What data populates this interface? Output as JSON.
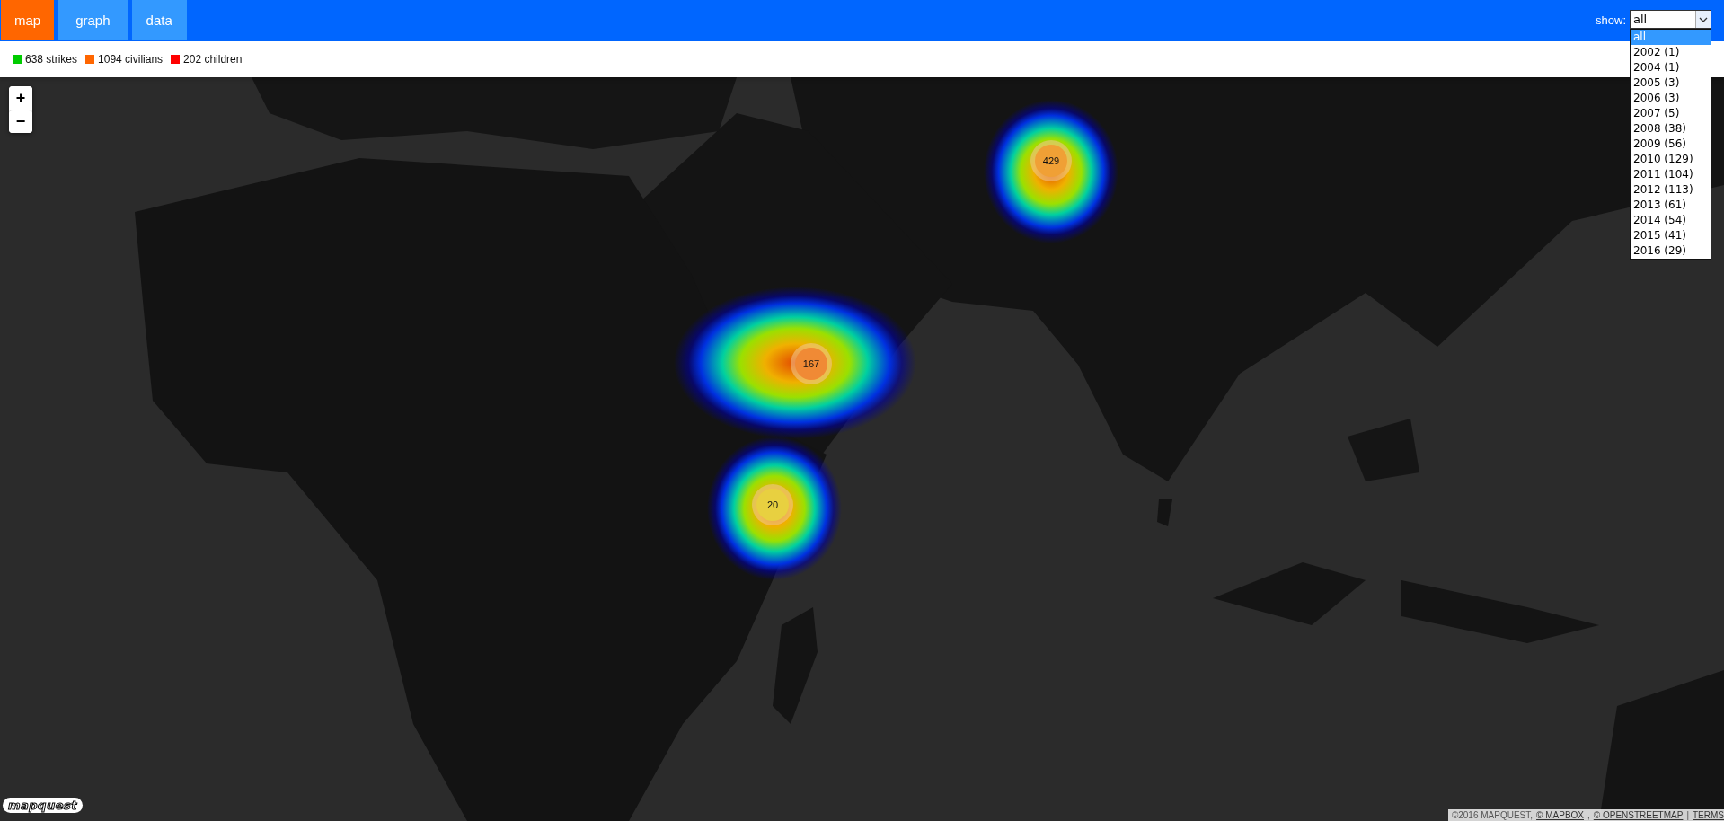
{
  "tabs": [
    {
      "label": "map",
      "selected": true
    },
    {
      "label": "graph",
      "selected": false
    },
    {
      "label": "data",
      "selected": false
    }
  ],
  "filter": {
    "label": "show:",
    "value": "all",
    "expanded": true,
    "options": [
      {
        "label": "all",
        "selected": true
      },
      {
        "label": "2002 (1)",
        "selected": false
      },
      {
        "label": "2004 (1)",
        "selected": false
      },
      {
        "label": "2005 (3)",
        "selected": false
      },
      {
        "label": "2006 (3)",
        "selected": false
      },
      {
        "label": "2007 (5)",
        "selected": false
      },
      {
        "label": "2008 (38)",
        "selected": false
      },
      {
        "label": "2009 (56)",
        "selected": false
      },
      {
        "label": "2010 (129)",
        "selected": false
      },
      {
        "label": "2011 (104)",
        "selected": false
      },
      {
        "label": "2012 (113)",
        "selected": false
      },
      {
        "label": "2013 (61)",
        "selected": false
      },
      {
        "label": "2014 (54)",
        "selected": false
      },
      {
        "label": "2015 (41)",
        "selected": false
      },
      {
        "label": "2016 (29)",
        "selected": false
      }
    ]
  },
  "legend": [
    {
      "label": "638 strikes",
      "color": "#00cc00"
    },
    {
      "label": "1094 civilians",
      "color": "#ff6600"
    },
    {
      "label": "202 children",
      "color": "#ff0000"
    }
  ],
  "map": {
    "kind": "picture",
    "zoom_in": "+",
    "zoom_out": "−",
    "clusters": [
      {
        "count": "429",
        "color": "#f0a035"
      },
      {
        "count": "167",
        "color": "#f08a35"
      },
      {
        "count": "20",
        "color": "#e8d040"
      }
    ],
    "logo": "mapquest",
    "attribution": [
      {
        "text": "©2016 MAPQUEST,",
        "link": false
      },
      {
        "text": "© MAPBOX",
        "link": true
      },
      {
        "text": ",",
        "link": false
      },
      {
        "text": "© OPENSTREETMAP",
        "link": true
      },
      {
        "text": "|",
        "link": false
      },
      {
        "text": "TERMS",
        "link": true
      }
    ]
  }
}
